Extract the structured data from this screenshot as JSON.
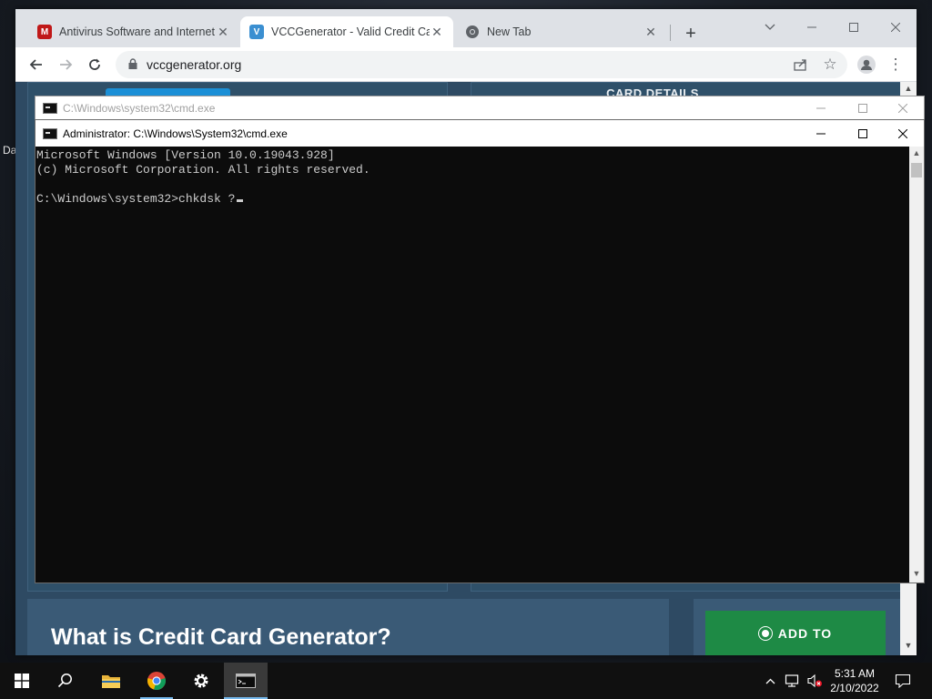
{
  "desktop": {
    "left_fragment_1": "Da"
  },
  "browser": {
    "tabs": [
      {
        "title": "Antivirus Software and Internet S",
        "icon": "mcafee-shield-icon",
        "color": "#c01818"
      },
      {
        "title": "VCCGenerator - Valid Credit Carc",
        "icon": "vcc-v-icon",
        "color": "#3b8fd1"
      },
      {
        "title": "New Tab",
        "icon": "chrome-icon"
      }
    ],
    "new_tab_label": "+",
    "url": "vccgenerator.org",
    "page": {
      "card_details_heading": "CARD DETAILS",
      "what_is_heading": "What is Credit Card Generator?",
      "add_to_button": "ADD TO"
    }
  },
  "cmd_background": {
    "title": "C:\\Windows\\system32\\cmd.exe"
  },
  "cmd_foreground": {
    "title": "Administrator: C:\\Windows\\System32\\cmd.exe",
    "console_lines": [
      "Microsoft Windows [Version 10.0.19043.928]",
      "(c) Microsoft Corporation. All rights reserved.",
      "",
      "C:\\Windows\\system32>chkdsk ?"
    ]
  },
  "taskbar": {
    "time": "5:31 AM",
    "date": "2/10/2022",
    "apps": [
      "start-icon",
      "search-icon",
      "file-explorer-icon",
      "chrome-icon",
      "settings-icon",
      "cmd-icon"
    ]
  },
  "colors": {
    "console_bg": "#0c0c0c",
    "console_fg": "#cccccc",
    "taskbar_accent": "#76b9ed",
    "add_to_green": "#1e8a45"
  }
}
